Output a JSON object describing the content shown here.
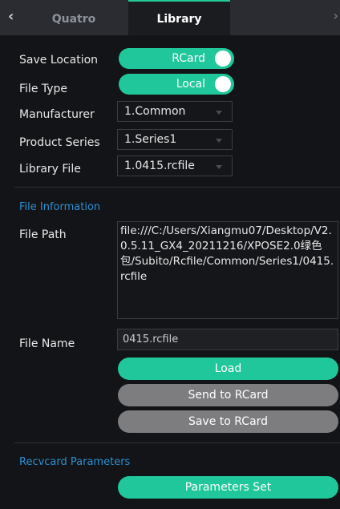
{
  "tabs": {
    "back_icon": "chevron-left-icon",
    "quatro": "Quatro",
    "library": "Library",
    "right_icon": "chevron-right-icon"
  },
  "settings": {
    "save_location_label": "Save Location",
    "save_location_value": "RCard",
    "file_type_label": "File Type",
    "file_type_value": "Local",
    "manufacturer_label": "Manufacturer",
    "manufacturer_value": "1.Common",
    "product_series_label": "Product Series",
    "product_series_value": "1.Series1",
    "library_file_label": "Library File",
    "library_file_value": "1.0415.rcfile"
  },
  "file_info": {
    "section_title": "File Information",
    "file_path_label": "File Path",
    "file_path_value": "file:///C:/Users/Xiangmu07/Desktop/V2.0.5.11_GX4_20211216/XPOSE2.0绿色包/Subito/Rcfile/Common/Series1/0415.rcfile",
    "file_name_label": "File Name",
    "file_name_value": "0415.rcfile",
    "load_button": "Load",
    "send_button": "Send to RCard",
    "save_button": "Save to RCard"
  },
  "recv": {
    "section_title": "Recvcard Parameters",
    "parameters_button": "Parameters Set"
  },
  "colors": {
    "accent": "#1fc79a",
    "section_title": "#2a8fd0",
    "disabled_button": "#7d7d7f",
    "background": "#131417"
  }
}
